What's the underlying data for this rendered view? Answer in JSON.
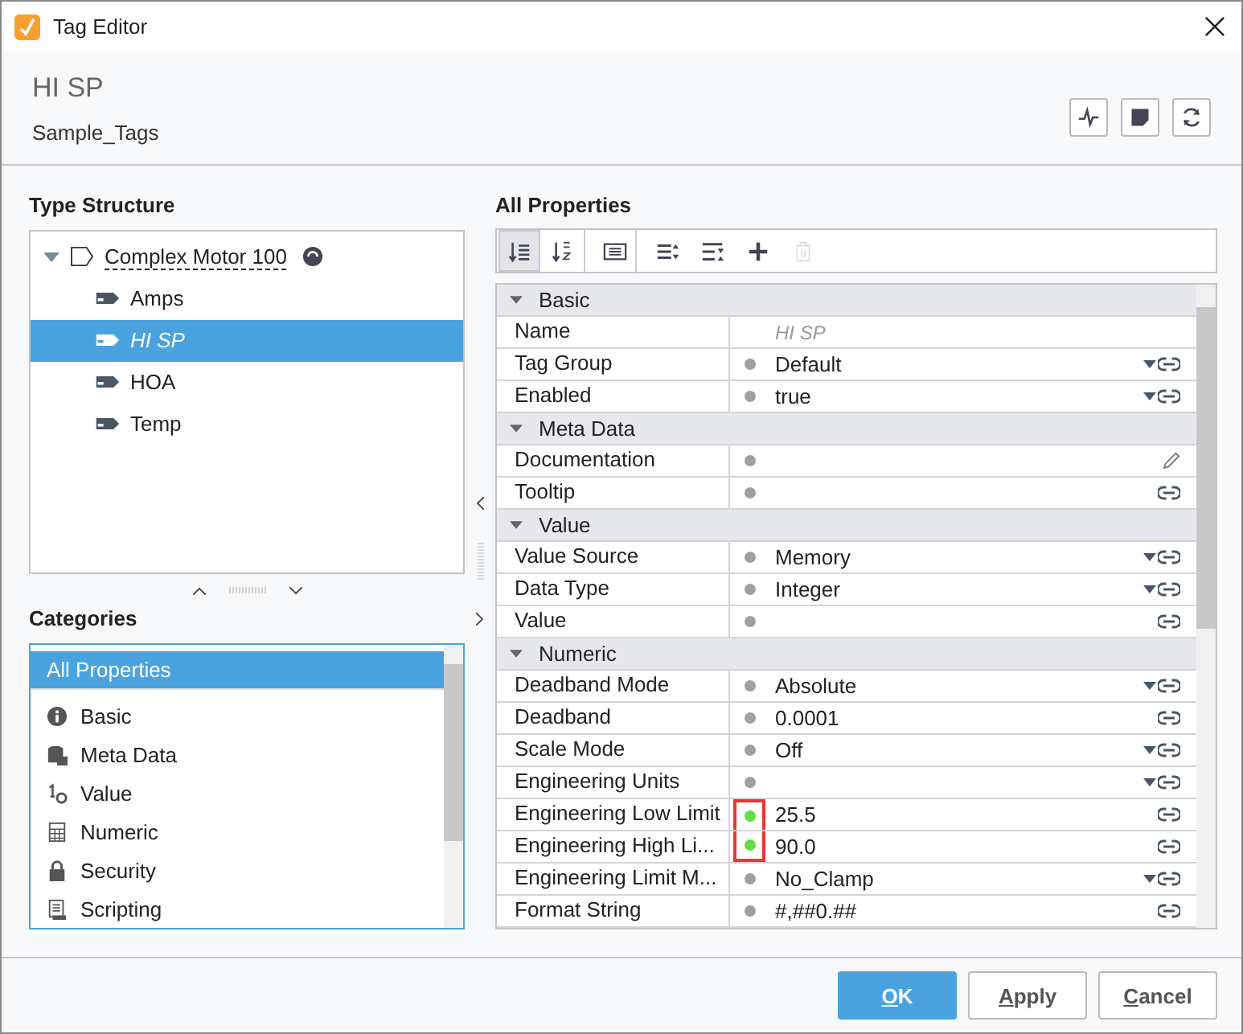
{
  "window": {
    "title": "Tag Editor"
  },
  "header": {
    "title": "HI SP",
    "subtitle": "Sample_Tags"
  },
  "type_structure": {
    "heading": "Type Structure",
    "root": {
      "label": "Complex Motor 100",
      "expanded": true,
      "children": [
        {
          "label": "Amps",
          "selected": false,
          "overridden": false
        },
        {
          "label": "HI SP",
          "selected": true,
          "overridden": true
        },
        {
          "label": "HOA",
          "selected": false,
          "overridden": false
        },
        {
          "label": "Temp",
          "selected": false,
          "overridden": false
        }
      ]
    }
  },
  "categories": {
    "heading": "Categories",
    "items": [
      {
        "label": "All Properties",
        "selected": true
      },
      {
        "label": "Basic",
        "selected": false
      },
      {
        "label": "Meta Data",
        "selected": false
      },
      {
        "label": "Value",
        "selected": false
      },
      {
        "label": "Numeric",
        "selected": false
      },
      {
        "label": "Security",
        "selected": false
      },
      {
        "label": "Scripting",
        "selected": false
      }
    ]
  },
  "properties": {
    "heading": "All Properties",
    "toolbar": [
      {
        "selected": true,
        "disabled": false
      },
      {
        "selected": false,
        "disabled": false
      },
      {
        "selected": false,
        "disabled": false
      },
      {
        "selected": false,
        "disabled": false
      },
      {
        "selected": false,
        "disabled": false
      },
      {
        "selected": false,
        "disabled": false
      },
      {
        "selected": false,
        "disabled": true
      }
    ],
    "rows": [
      {
        "kind": "group",
        "label": "Basic",
        "expanded": true
      },
      {
        "kind": "prop",
        "name": "Name",
        "value": "HI SP",
        "readonly": true,
        "dropdown": false,
        "bindable": false,
        "editable": false,
        "highlight": false
      },
      {
        "kind": "prop",
        "name": "Tag Group",
        "value": "Default",
        "color": "#a0a0a0",
        "dropdown": true,
        "bindable": true,
        "editable": false,
        "highlight": false
      },
      {
        "kind": "prop",
        "name": "Enabled",
        "value": "true",
        "color": "#a0a0a0",
        "dropdown": true,
        "bindable": true,
        "editable": false,
        "highlight": false
      },
      {
        "kind": "group",
        "label": "Meta Data",
        "expanded": true
      },
      {
        "kind": "prop",
        "name": "Documentation",
        "color": "#a0a0a0",
        "dropdown": false,
        "bindable": false,
        "editable": true,
        "highlight": false
      },
      {
        "kind": "prop",
        "name": "Tooltip",
        "color": "#a0a0a0",
        "dropdown": false,
        "bindable": true,
        "editable": false,
        "highlight": false
      },
      {
        "kind": "group",
        "label": "Value",
        "expanded": true
      },
      {
        "kind": "prop",
        "name": "Value Source",
        "value": "Memory",
        "color": "#a0a0a0",
        "dropdown": true,
        "bindable": true,
        "editable": false,
        "highlight": false
      },
      {
        "kind": "prop",
        "name": "Data Type",
        "value": "Integer",
        "color": "#a0a0a0",
        "dropdown": true,
        "bindable": true,
        "editable": false,
        "highlight": false
      },
      {
        "kind": "prop",
        "name": "Value",
        "color": "#a0a0a0",
        "dropdown": false,
        "bindable": true,
        "editable": false,
        "highlight": false
      },
      {
        "kind": "group",
        "label": "Numeric",
        "expanded": true
      },
      {
        "kind": "prop",
        "name": "Deadband Mode",
        "value": "Absolute",
        "color": "#a0a0a0",
        "dropdown": true,
        "bindable": true,
        "editable": false,
        "highlight": false
      },
      {
        "kind": "prop",
        "name": "Deadband",
        "value": "0.0001",
        "color": "#a0a0a0",
        "dropdown": false,
        "bindable": true,
        "editable": false,
        "highlight": false
      },
      {
        "kind": "prop",
        "name": "Scale Mode",
        "value": "Off",
        "color": "#a0a0a0",
        "dropdown": true,
        "bindable": true,
        "editable": false,
        "highlight": false
      },
      {
        "kind": "prop",
        "name": "Engineering Units",
        "color": "#a0a0a0",
        "dropdown": true,
        "bindable": true,
        "editable": false,
        "highlight": false
      },
      {
        "kind": "prop",
        "name": "Engineering Low Limit",
        "value": "25.5",
        "color": "#66dd44",
        "dropdown": false,
        "bindable": true,
        "editable": false,
        "highlight": true
      },
      {
        "kind": "prop",
        "name": "Engineering High Li...",
        "value": "90.0",
        "color": "#66dd44",
        "dropdown": false,
        "bindable": true,
        "editable": false,
        "highlight": true
      },
      {
        "kind": "prop",
        "name": "Engineering Limit M...",
        "value": "No_Clamp",
        "color": "#a0a0a0",
        "dropdown": true,
        "bindable": true,
        "editable": false,
        "highlight": false
      },
      {
        "kind": "prop",
        "name": "Format String",
        "value": "#,##0.##",
        "color": "#a0a0a0",
        "dropdown": false,
        "bindable": true,
        "editable": false,
        "highlight": false
      }
    ]
  },
  "buttons": [
    {
      "label": "OK",
      "primary": true
    },
    {
      "label": "Apply",
      "primary": false
    },
    {
      "label": "Cancel",
      "primary": false
    }
  ]
}
